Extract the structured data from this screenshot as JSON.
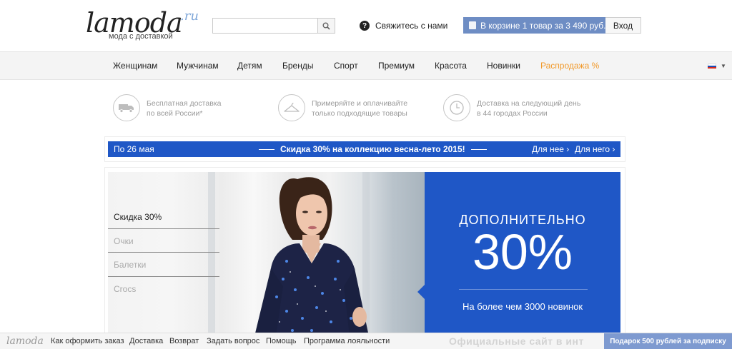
{
  "header": {
    "logo_main": "lamoda",
    "logo_tld": ".ru",
    "logo_tagline": "мода с доставкой",
    "search_value": "",
    "contact_label": "Свяжитесь с нами",
    "cart_label": "В корзине 1 товар за 3 490 руб.",
    "login_label": "Вход"
  },
  "nav": {
    "items": [
      "Женщинам",
      "Мужчинам",
      "Детям",
      "Бренды",
      "Спорт",
      "Премиум",
      "Красота",
      "Новинки",
      "Распродажа %"
    ],
    "sale_color": "#f19a2c",
    "language_flag": "russia-flag-icon"
  },
  "benefits": [
    {
      "icon": "truck-icon",
      "line1": "Бесплатная доставка",
      "line2": "по всей России*"
    },
    {
      "icon": "hanger-icon",
      "line1": "Примеряйте и оплачивайте",
      "line2": "только подходящие товары"
    },
    {
      "icon": "clock-icon",
      "line1": "Доставка на следующий день",
      "line2": "в 44 городах России"
    }
  ],
  "promo": {
    "date": "По 26 мая",
    "headline": "Скидка 30% на коллекцию весна-лето 2015!",
    "link_her": "Для нее",
    "link_him": "Для него",
    "color": "#1f57c6"
  },
  "banner": {
    "menu": [
      "Скидка 30%",
      "Очки",
      "Балетки",
      "Crocs"
    ],
    "label": "ДОПОЛНИТЕЛЬНО",
    "percent": "30%",
    "subtitle": "На более чем 3000 новинок",
    "panel_color": "#1f57c6"
  },
  "footer": {
    "logo": "lamoda",
    "links": [
      "Как оформить заказ",
      "Доставка",
      "Возврат",
      "Задать вопрос",
      "Помощь",
      "Программа лояльности"
    ],
    "watermark": "Официальные сайт в инт",
    "subscribe": "Подарок 500 рублей за подписку"
  }
}
